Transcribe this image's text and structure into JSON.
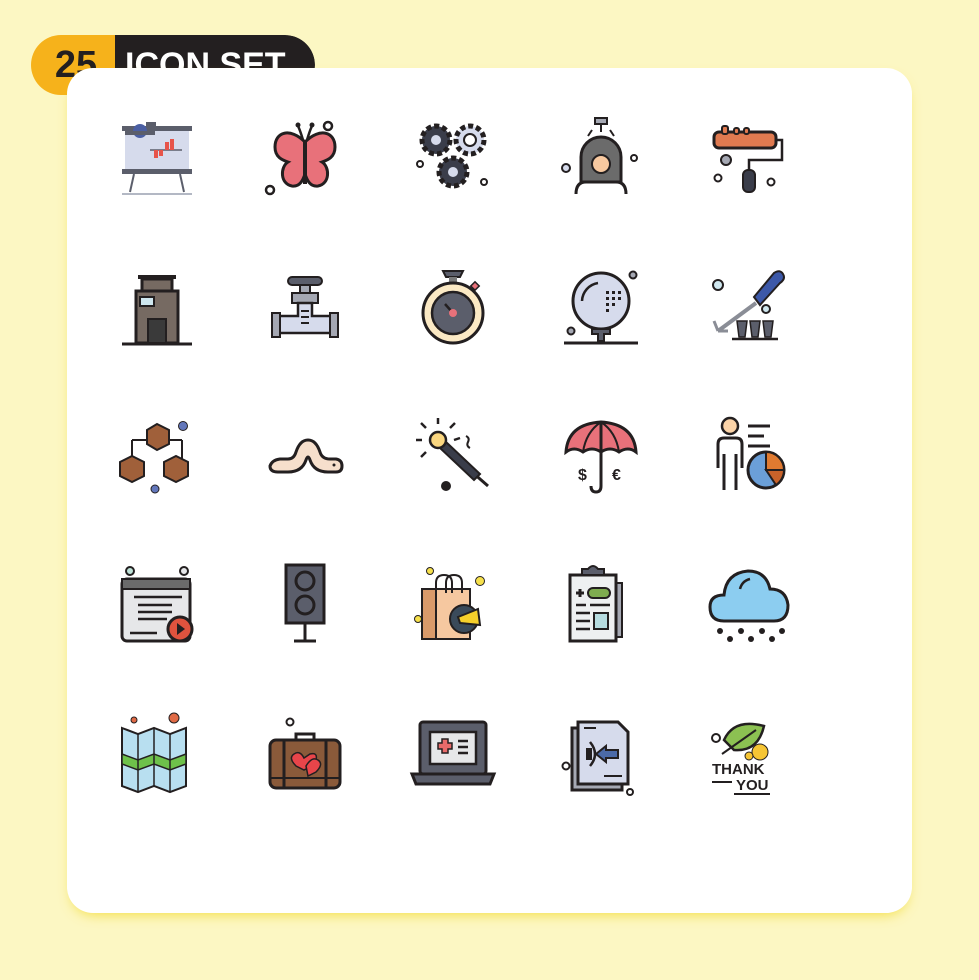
{
  "header": {
    "count": "25",
    "title": "ICON SET"
  },
  "colors": {
    "background": "#fcf7c3",
    "badge_accent": "#f6b21b",
    "badge_dark": "#231f20",
    "card": "#ffffff"
  },
  "icons": [
    {
      "name": "presentation-board-icon"
    },
    {
      "name": "butterfly-icon"
    },
    {
      "name": "gears-money-icon"
    },
    {
      "name": "hair-dryer-salon-icon"
    },
    {
      "name": "paint-roller-icon"
    },
    {
      "name": "building-icon"
    },
    {
      "name": "pipe-valve-icon"
    },
    {
      "name": "stopwatch-icon"
    },
    {
      "name": "golf-ball-icon"
    },
    {
      "name": "screwdriver-screws-icon"
    },
    {
      "name": "cubes-network-icon"
    },
    {
      "name": "worm-icon"
    },
    {
      "name": "sparkler-icon"
    },
    {
      "name": "umbrella-currency-icon"
    },
    {
      "name": "user-pie-chart-icon"
    },
    {
      "name": "video-browser-icon"
    },
    {
      "name": "speaker-icon"
    },
    {
      "name": "shopping-bag-megaphone-icon"
    },
    {
      "name": "clipboard-report-icon"
    },
    {
      "name": "snow-cloud-icon"
    },
    {
      "name": "folded-map-icon"
    },
    {
      "name": "honeymoon-suitcase-icon"
    },
    {
      "name": "medical-laptop-icon"
    },
    {
      "name": "file-import-icon"
    },
    {
      "name": "thank-you-leaf-icon"
    }
  ],
  "thank_you": {
    "line1": "THANK",
    "line2": "YOU"
  },
  "currency": {
    "left": "$",
    "right": "€"
  }
}
